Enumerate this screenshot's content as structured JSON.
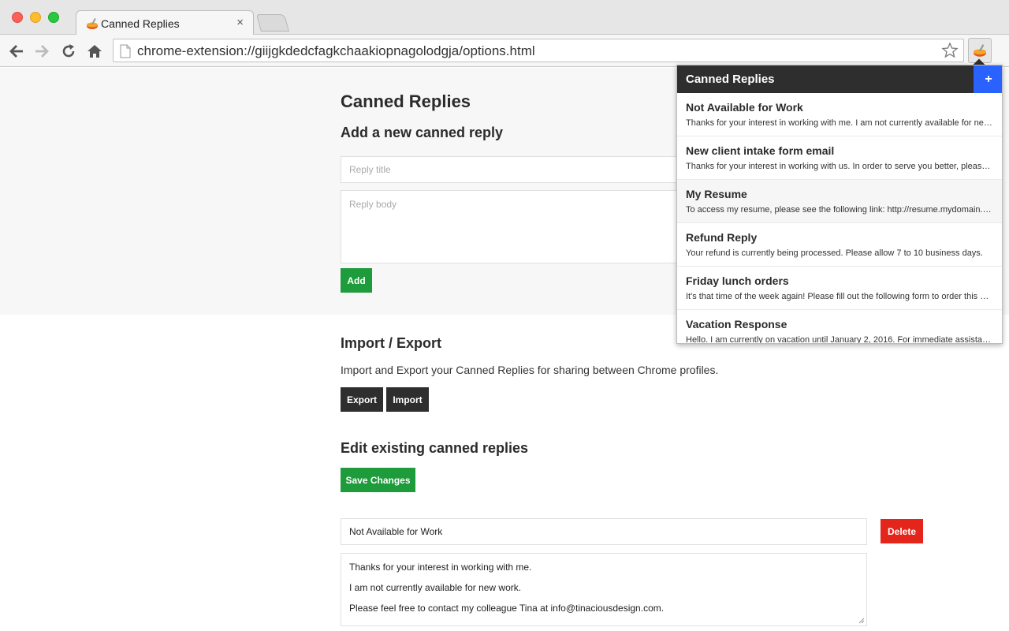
{
  "browser": {
    "tab_title": "Canned Replies",
    "tab_close": "×",
    "url": "chrome-extension://giijgkdedcfagkchaakiopnagolodgja/options.html"
  },
  "page": {
    "title": "Canned Replies",
    "add_heading": "Add a new canned reply",
    "reply_title_placeholder": "Reply title",
    "reply_body_placeholder": "Reply body",
    "add_label": "Add",
    "import_heading": "Import / Export",
    "import_description": "Import and Export your Canned Replies for sharing between Chrome profiles.",
    "export_label": "Export",
    "import_label": "Import",
    "edit_heading": "Edit existing canned replies",
    "save_label": "Save Changes",
    "existing": [
      {
        "title": "Not Available for Work",
        "delete_label": "Delete",
        "body_lines": [
          "Thanks for your interest in working with me.",
          "I am not currently available for new work.",
          "Please feel free to contact my colleague Tina at info@tinaciousdesign.com."
        ]
      }
    ]
  },
  "popup": {
    "title": "Canned Replies",
    "add_label": "+",
    "items": [
      {
        "title": "Not Available for Work",
        "body": "Thanks for your interest in working with me. I am not currently available for new work."
      },
      {
        "title": "New client intake form email",
        "body": "Thanks for your interest in working with us. In order to serve you better, please fill out the form."
      },
      {
        "title": "My Resume",
        "body": "To access my resume, please see the following link: http://resume.mydomain.com"
      },
      {
        "title": "Refund Reply",
        "body": "Your refund is currently being processed. Please allow 7 to 10 business days."
      },
      {
        "title": "Friday lunch orders",
        "body": "It's that time of the week again! Please fill out the following form to order this week."
      },
      {
        "title": "Vacation Response",
        "body": "Hello. I am currently on vacation until January 2, 2016. For immediate assistance"
      }
    ]
  },
  "colors": {
    "green": "#1e9b3b",
    "dark": "#2e2e2e",
    "red": "#e4251c",
    "blue": "#2962ff"
  },
  "icons": [
    "back-arrow-icon",
    "forward-arrow-icon",
    "reload-icon",
    "home-icon",
    "page-icon",
    "star-icon",
    "canned-replies-extension-icon",
    "resize-grip-icon"
  ]
}
